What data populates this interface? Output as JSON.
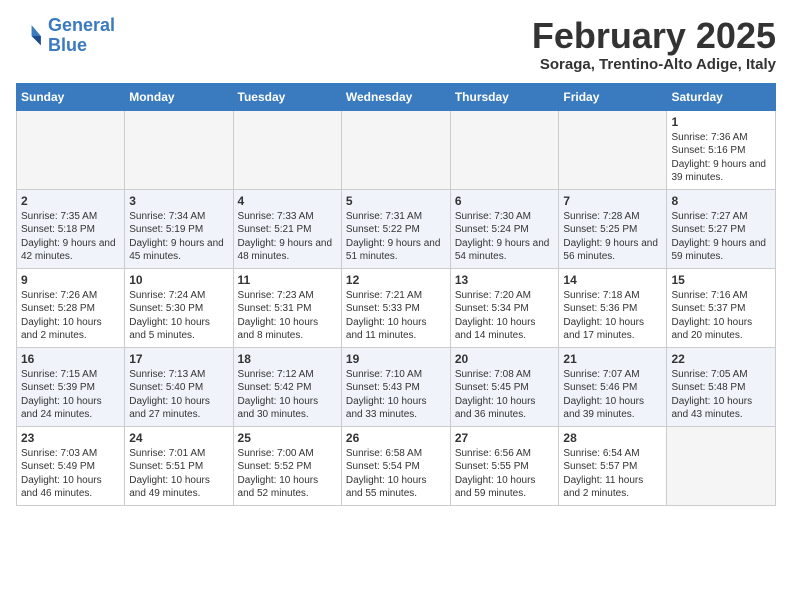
{
  "header": {
    "logo_line1": "General",
    "logo_line2": "Blue",
    "month": "February 2025",
    "location": "Soraga, Trentino-Alto Adige, Italy"
  },
  "weekdays": [
    "Sunday",
    "Monday",
    "Tuesday",
    "Wednesday",
    "Thursday",
    "Friday",
    "Saturday"
  ],
  "weeks": [
    [
      {
        "day": "",
        "info": ""
      },
      {
        "day": "",
        "info": ""
      },
      {
        "day": "",
        "info": ""
      },
      {
        "day": "",
        "info": ""
      },
      {
        "day": "",
        "info": ""
      },
      {
        "day": "",
        "info": ""
      },
      {
        "day": "1",
        "info": "Sunrise: 7:36 AM\nSunset: 5:16 PM\nDaylight: 9 hours and 39 minutes."
      }
    ],
    [
      {
        "day": "2",
        "info": "Sunrise: 7:35 AM\nSunset: 5:18 PM\nDaylight: 9 hours and 42 minutes."
      },
      {
        "day": "3",
        "info": "Sunrise: 7:34 AM\nSunset: 5:19 PM\nDaylight: 9 hours and 45 minutes."
      },
      {
        "day": "4",
        "info": "Sunrise: 7:33 AM\nSunset: 5:21 PM\nDaylight: 9 hours and 48 minutes."
      },
      {
        "day": "5",
        "info": "Sunrise: 7:31 AM\nSunset: 5:22 PM\nDaylight: 9 hours and 51 minutes."
      },
      {
        "day": "6",
        "info": "Sunrise: 7:30 AM\nSunset: 5:24 PM\nDaylight: 9 hours and 54 minutes."
      },
      {
        "day": "7",
        "info": "Sunrise: 7:28 AM\nSunset: 5:25 PM\nDaylight: 9 hours and 56 minutes."
      },
      {
        "day": "8",
        "info": "Sunrise: 7:27 AM\nSunset: 5:27 PM\nDaylight: 9 hours and 59 minutes."
      }
    ],
    [
      {
        "day": "9",
        "info": "Sunrise: 7:26 AM\nSunset: 5:28 PM\nDaylight: 10 hours and 2 minutes."
      },
      {
        "day": "10",
        "info": "Sunrise: 7:24 AM\nSunset: 5:30 PM\nDaylight: 10 hours and 5 minutes."
      },
      {
        "day": "11",
        "info": "Sunrise: 7:23 AM\nSunset: 5:31 PM\nDaylight: 10 hours and 8 minutes."
      },
      {
        "day": "12",
        "info": "Sunrise: 7:21 AM\nSunset: 5:33 PM\nDaylight: 10 hours and 11 minutes."
      },
      {
        "day": "13",
        "info": "Sunrise: 7:20 AM\nSunset: 5:34 PM\nDaylight: 10 hours and 14 minutes."
      },
      {
        "day": "14",
        "info": "Sunrise: 7:18 AM\nSunset: 5:36 PM\nDaylight: 10 hours and 17 minutes."
      },
      {
        "day": "15",
        "info": "Sunrise: 7:16 AM\nSunset: 5:37 PM\nDaylight: 10 hours and 20 minutes."
      }
    ],
    [
      {
        "day": "16",
        "info": "Sunrise: 7:15 AM\nSunset: 5:39 PM\nDaylight: 10 hours and 24 minutes."
      },
      {
        "day": "17",
        "info": "Sunrise: 7:13 AM\nSunset: 5:40 PM\nDaylight: 10 hours and 27 minutes."
      },
      {
        "day": "18",
        "info": "Sunrise: 7:12 AM\nSunset: 5:42 PM\nDaylight: 10 hours and 30 minutes."
      },
      {
        "day": "19",
        "info": "Sunrise: 7:10 AM\nSunset: 5:43 PM\nDaylight: 10 hours and 33 minutes."
      },
      {
        "day": "20",
        "info": "Sunrise: 7:08 AM\nSunset: 5:45 PM\nDaylight: 10 hours and 36 minutes."
      },
      {
        "day": "21",
        "info": "Sunrise: 7:07 AM\nSunset: 5:46 PM\nDaylight: 10 hours and 39 minutes."
      },
      {
        "day": "22",
        "info": "Sunrise: 7:05 AM\nSunset: 5:48 PM\nDaylight: 10 hours and 43 minutes."
      }
    ],
    [
      {
        "day": "23",
        "info": "Sunrise: 7:03 AM\nSunset: 5:49 PM\nDaylight: 10 hours and 46 minutes."
      },
      {
        "day": "24",
        "info": "Sunrise: 7:01 AM\nSunset: 5:51 PM\nDaylight: 10 hours and 49 minutes."
      },
      {
        "day": "25",
        "info": "Sunrise: 7:00 AM\nSunset: 5:52 PM\nDaylight: 10 hours and 52 minutes."
      },
      {
        "day": "26",
        "info": "Sunrise: 6:58 AM\nSunset: 5:54 PM\nDaylight: 10 hours and 55 minutes."
      },
      {
        "day": "27",
        "info": "Sunrise: 6:56 AM\nSunset: 5:55 PM\nDaylight: 10 hours and 59 minutes."
      },
      {
        "day": "28",
        "info": "Sunrise: 6:54 AM\nSunset: 5:57 PM\nDaylight: 11 hours and 2 minutes."
      },
      {
        "day": "",
        "info": ""
      }
    ]
  ]
}
